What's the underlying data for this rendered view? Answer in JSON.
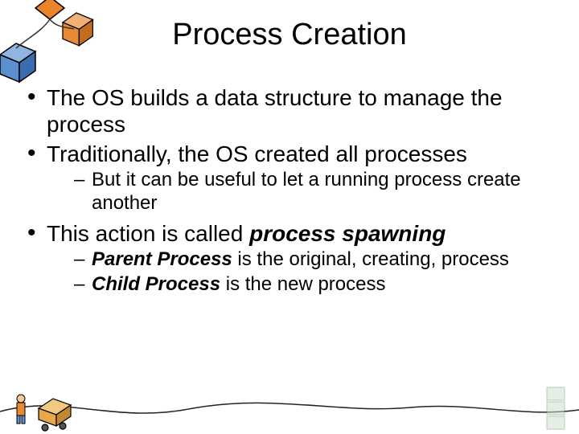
{
  "title": "Process Creation",
  "bullets": [
    {
      "text": "The OS builds a data structure to manage the process",
      "sub": []
    },
    {
      "text": "Traditionally, the OS created all processes",
      "sub": [
        {
          "prefix": "",
          "main": "But it can be useful to let a running process create another",
          "suffix": ""
        }
      ]
    },
    {
      "text_prefix": "This action is called ",
      "text_emph": "process spawning",
      "sub": [
        {
          "prefix": "Parent Process",
          "main": " is the original, creating, process",
          "suffix": ""
        },
        {
          "prefix": "Child Process",
          "main": " is the new process",
          "suffix": ""
        }
      ]
    }
  ],
  "decorations": {
    "top_icon": "boxes-and-diamond-icon",
    "bottom_icon": "figure-with-cart-icon"
  }
}
